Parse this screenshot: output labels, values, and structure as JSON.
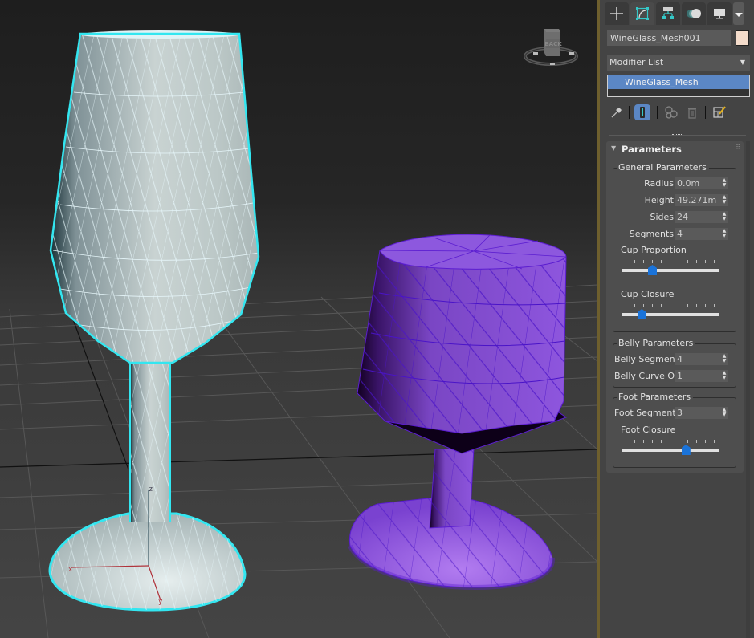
{
  "viewport": {
    "viewcube_face_label": "BACK",
    "axis_labels": {
      "x": "x",
      "y": "y",
      "z": "z"
    },
    "objects": [
      {
        "name": "WineGlass_Mesh001",
        "selected": true,
        "wire_color": "#d8e2e2",
        "selection_outline": "#33e6f0"
      },
      {
        "name": "WineGlass_Mesh",
        "selected": false,
        "wire_color": "#8a4fd6",
        "edge_color": "#5b1dd0"
      }
    ]
  },
  "command_panel": {
    "tabs": [
      {
        "name": "create",
        "icon": "plus-icon",
        "active": false
      },
      {
        "name": "modify",
        "icon": "modify-icon",
        "active": true
      },
      {
        "name": "hierarchy",
        "icon": "hierarchy-icon",
        "active": false
      },
      {
        "name": "motion",
        "icon": "motion-icon",
        "active": false
      },
      {
        "name": "display",
        "icon": "display-icon",
        "active": false
      },
      {
        "name": "utilities",
        "icon": "wrench-icon",
        "active": false
      }
    ],
    "object_name": "WineGlass_Mesh001",
    "object_color": "#f4dccb",
    "modifier_list_label": "Modifier List",
    "modifier_stack": [
      "WineGlass_Mesh"
    ],
    "stack_tools": [
      "pin-stack",
      "show-end-result",
      "make-unique",
      "remove-modifier",
      "configure-modifier-sets"
    ],
    "rollout": {
      "title": "Parameters",
      "general": {
        "title": "General Parameters",
        "radius_label": "Radius",
        "radius_value": "0.0m",
        "height_label": "Height",
        "height_value": "49.271m",
        "sides_label": "Sides",
        "sides_value": "24",
        "segments_label": "Segments",
        "segments_value": "4",
        "cup_proportion_label": "Cup Proportion",
        "cup_proportion_value": 0.3,
        "cup_closure_label": "Cup Closure",
        "cup_closure_value": 0.18
      },
      "belly": {
        "title": "Belly Parameters",
        "segments_label": "Belly Segments",
        "segments_value": "4",
        "curve_label": "Belly Curve On",
        "curve_value": "1"
      },
      "foot": {
        "title": "Foot Parameters",
        "segments_label": "Foot Segments",
        "segments_value": "3",
        "closure_label": "Foot Closure",
        "closure_value": 0.68
      }
    }
  }
}
